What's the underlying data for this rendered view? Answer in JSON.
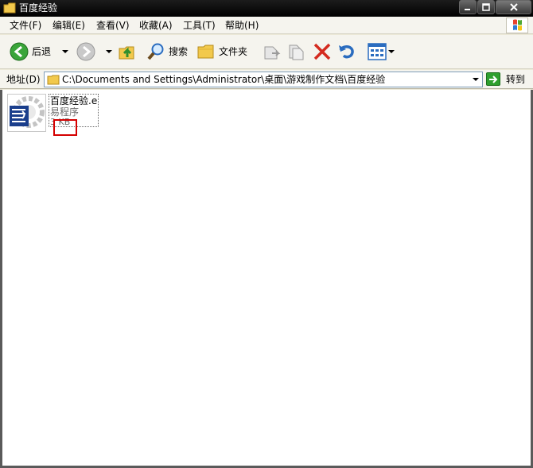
{
  "window": {
    "title": "百度经验",
    "buttons": {
      "minimize": "minimize",
      "maximize": "maximize",
      "close": "close"
    }
  },
  "menu": [
    "文件(F)",
    "编辑(E)",
    "查看(V)",
    "收藏(A)",
    "工具(T)",
    "帮助(H)"
  ],
  "toolbar": {
    "back_label": "后退",
    "search_label": "搜索",
    "folders_label": "文件夹"
  },
  "address": {
    "label": "地址(D)",
    "path": "C:\\Documents and Settings\\Administrator\\桌面\\游戏制作文档\\百度经验",
    "go_label": "转到"
  },
  "files": [
    {
      "name": "百度经验.e",
      "type": "易程序",
      "size": "3 KB"
    }
  ],
  "colors": {
    "titlebar": "#000000",
    "highlight": "#d40000",
    "go_green": "#2e9f2e"
  }
}
